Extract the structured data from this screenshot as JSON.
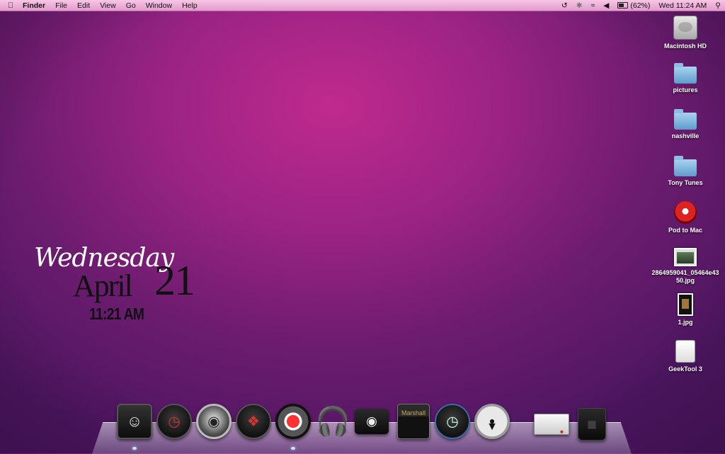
{
  "menubar": {
    "app_name": "Finder",
    "menus": [
      "File",
      "Edit",
      "View",
      "Go",
      "Window",
      "Help"
    ],
    "status": {
      "battery_label": "(62%)",
      "datetime": "Wed 11:24 AM"
    }
  },
  "desktop_icons": [
    {
      "label": "Macintosh HD",
      "icon": "hard-drive-icon"
    },
    {
      "label": "pictures",
      "icon": "folder-icon"
    },
    {
      "label": "nashville",
      "icon": "folder-icon"
    },
    {
      "label": "Tony Tunes",
      "icon": "folder-icon"
    },
    {
      "label": "Pod to Mac",
      "icon": "pod-to-mac-icon"
    },
    {
      "label": "2864959041_05464e4350.jpg",
      "icon": "image-file-icon"
    },
    {
      "label": "1.jpg",
      "icon": "image-file-icon"
    },
    {
      "label": "GeekTool 3",
      "icon": "disk-image-icon"
    }
  ],
  "widget": {
    "day": "Wednesday",
    "month": "April",
    "date": "21",
    "time": "11:21 AM"
  },
  "dock": {
    "items": [
      {
        "name": "finder",
        "icon": "finder-icon"
      },
      {
        "name": "dashboard",
        "icon": "dashboard-icon"
      },
      {
        "name": "firefox",
        "icon": "firefox-icon"
      },
      {
        "name": "safari",
        "icon": "safari-icon"
      },
      {
        "name": "chrome",
        "icon": "chrome-icon"
      },
      {
        "name": "itunes",
        "icon": "headphones-icon"
      },
      {
        "name": "iphoto",
        "icon": "camera-icon"
      },
      {
        "name": "garageband",
        "icon": "amplifier-icon"
      },
      {
        "name": "time-machine",
        "icon": "time-machine-icon"
      },
      {
        "name": "dvd-player",
        "icon": "dvd-icon"
      },
      {
        "name": "preview",
        "icon": "preview-icon"
      },
      {
        "name": "trash",
        "icon": "trash-icon"
      }
    ]
  },
  "colors": {
    "wallpaper_center": "#c02a8e",
    "wallpaper_edge": "#4c1660",
    "menubar": "#f0b6dc"
  }
}
